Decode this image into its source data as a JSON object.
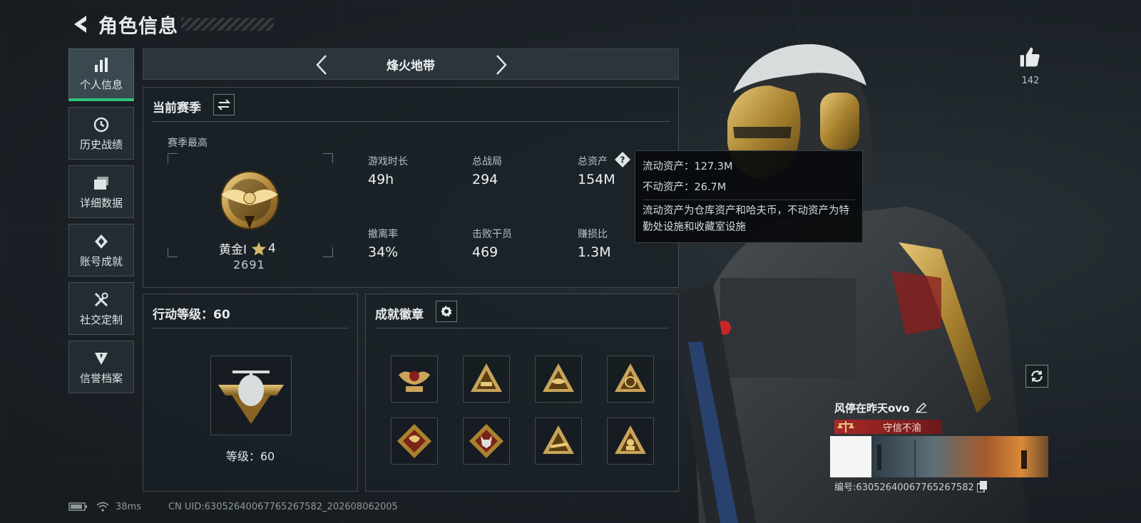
{
  "header": {
    "title": "角色信息"
  },
  "sidebar": {
    "items": [
      {
        "label": "个人信息",
        "icon": "bar-chart-icon",
        "active": true
      },
      {
        "label": "历史战绩",
        "icon": "clock-history-icon"
      },
      {
        "label": "详细数据",
        "icon": "folder-stack-icon"
      },
      {
        "label": "账号成就",
        "icon": "achievement-diamond-icon"
      },
      {
        "label": "社交定制",
        "icon": "tools-icon"
      },
      {
        "label": "信誉档案",
        "icon": "shield-emblem-icon"
      }
    ]
  },
  "season_nav": {
    "title": "烽火地带"
  },
  "current_season": {
    "title": "当前赛季",
    "best_label": "赛季最高",
    "rank_name": "黄金Ⅰ",
    "rank_stars": "4",
    "rank_points": "2691",
    "stats": [
      {
        "label": "游戏时长",
        "value": "49h"
      },
      {
        "label": "总战局",
        "value": "294"
      },
      {
        "label": "总资产",
        "value": "154M"
      },
      {
        "label": "撤离率",
        "value": "34%"
      },
      {
        "label": "击败干员",
        "value": "469"
      },
      {
        "label": "赚损比",
        "value": "1.3M"
      }
    ]
  },
  "tooltip": {
    "liquid": "流动资产：127.3M",
    "fixed": "不动资产：26.7M",
    "note": "流动资产为仓库资产和哈夫币，不动资产为特勤处设施和收藏室设施"
  },
  "action_level": {
    "title": "行动等级：60",
    "level_text": "等级：60"
  },
  "achievements": {
    "title": "成就徽章",
    "badges": [
      "badge-winged-crest-icon",
      "badge-tank-triangle-icon",
      "badge-eagle-triangle-icon",
      "badge-eri-triangle-icon",
      "badge-dragon-diamond-icon",
      "badge-wolf-diamond-icon",
      "badge-plane-triangle-icon",
      "badge-soldier-triangle-icon"
    ]
  },
  "likes": {
    "count": "142"
  },
  "player": {
    "name": "风停在昨天ovo",
    "reputation": "守信不渝",
    "id_text": "编号:6305264006776526758​2"
  },
  "status_bar": {
    "ping": "38ms",
    "uid": "CN UID:6305264006776526758​2_202608062005"
  },
  "colors": {
    "accent_green": "#2fc37e",
    "gold": "#c9a45a",
    "reputation_red": "#8a1f1f"
  }
}
